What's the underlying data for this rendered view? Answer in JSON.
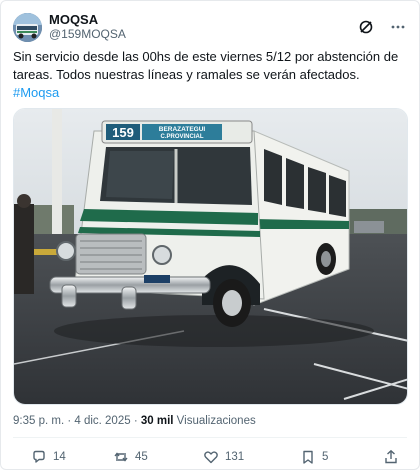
{
  "author": {
    "display_name": "MOQSA",
    "handle": "@159MOQSA"
  },
  "tweet": {
    "text": "Sin servicio desde las 00hs de este viernes 5/12 por abstención de tareas. Todos nuestras líneas y ramales se verán afectados.",
    "hashtag": "#Moqsa"
  },
  "media": {
    "bus_route_number": "159",
    "bus_sign_line1": "BERAZATEGUI",
    "bus_sign_line2": "C.PROVINCIAL"
  },
  "meta": {
    "timestamp": "9:35 p. m. · 4 dic. 2025",
    "separator": " · ",
    "views_count": "30 mil",
    "views_label": "Visualizaciones"
  },
  "actions": {
    "replies": "14",
    "retweets": "45",
    "likes": "131",
    "bookmarks": "5"
  },
  "colors": {
    "accent": "#1d9bf0",
    "text": "#0f1419",
    "muted": "#536471"
  }
}
